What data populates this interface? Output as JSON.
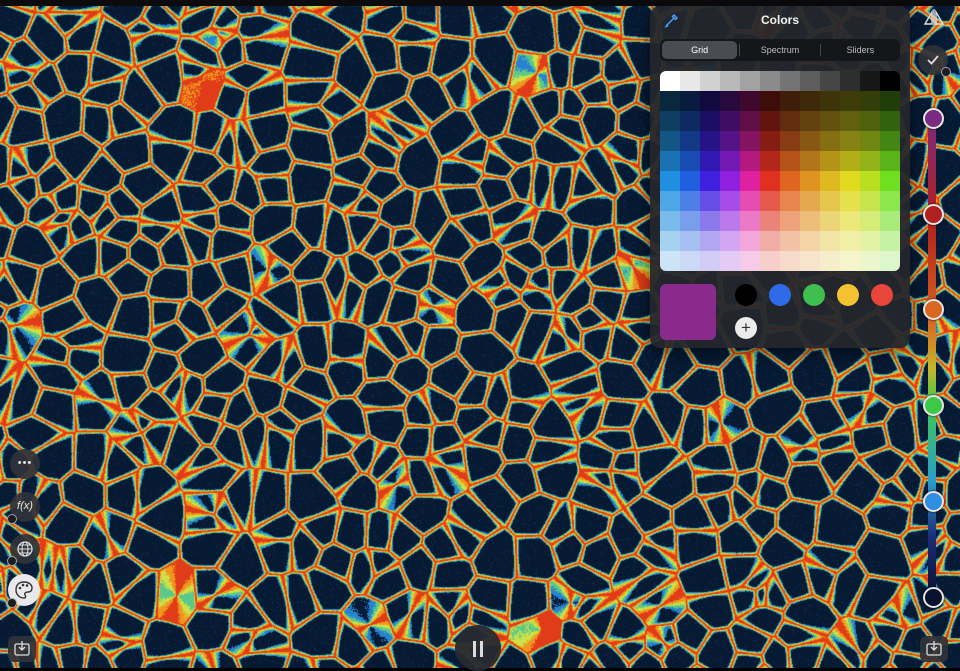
{
  "panel": {
    "title": "Colors",
    "tabs": [
      {
        "label": "Grid",
        "active": true
      },
      {
        "label": "Spectrum",
        "active": false
      },
      {
        "label": "Sliders",
        "active": false
      }
    ],
    "current_color": "#8b2a8d",
    "saved_colors": [
      "#000000",
      "#2f6be8",
      "#3fbf4f",
      "#f4c231",
      "#e8463a"
    ],
    "add_label": "+"
  },
  "left_toolbar": {
    "more_label": "•••",
    "function_label": "f(x)"
  },
  "gradient_stops": [
    "#7a2a80",
    "#b0201e",
    "#d8671f",
    "#3dc84a",
    "#2e8ee0",
    "#0a1230"
  ],
  "colors": {
    "background": "#061a33",
    "panel_bg": "#24262c"
  }
}
